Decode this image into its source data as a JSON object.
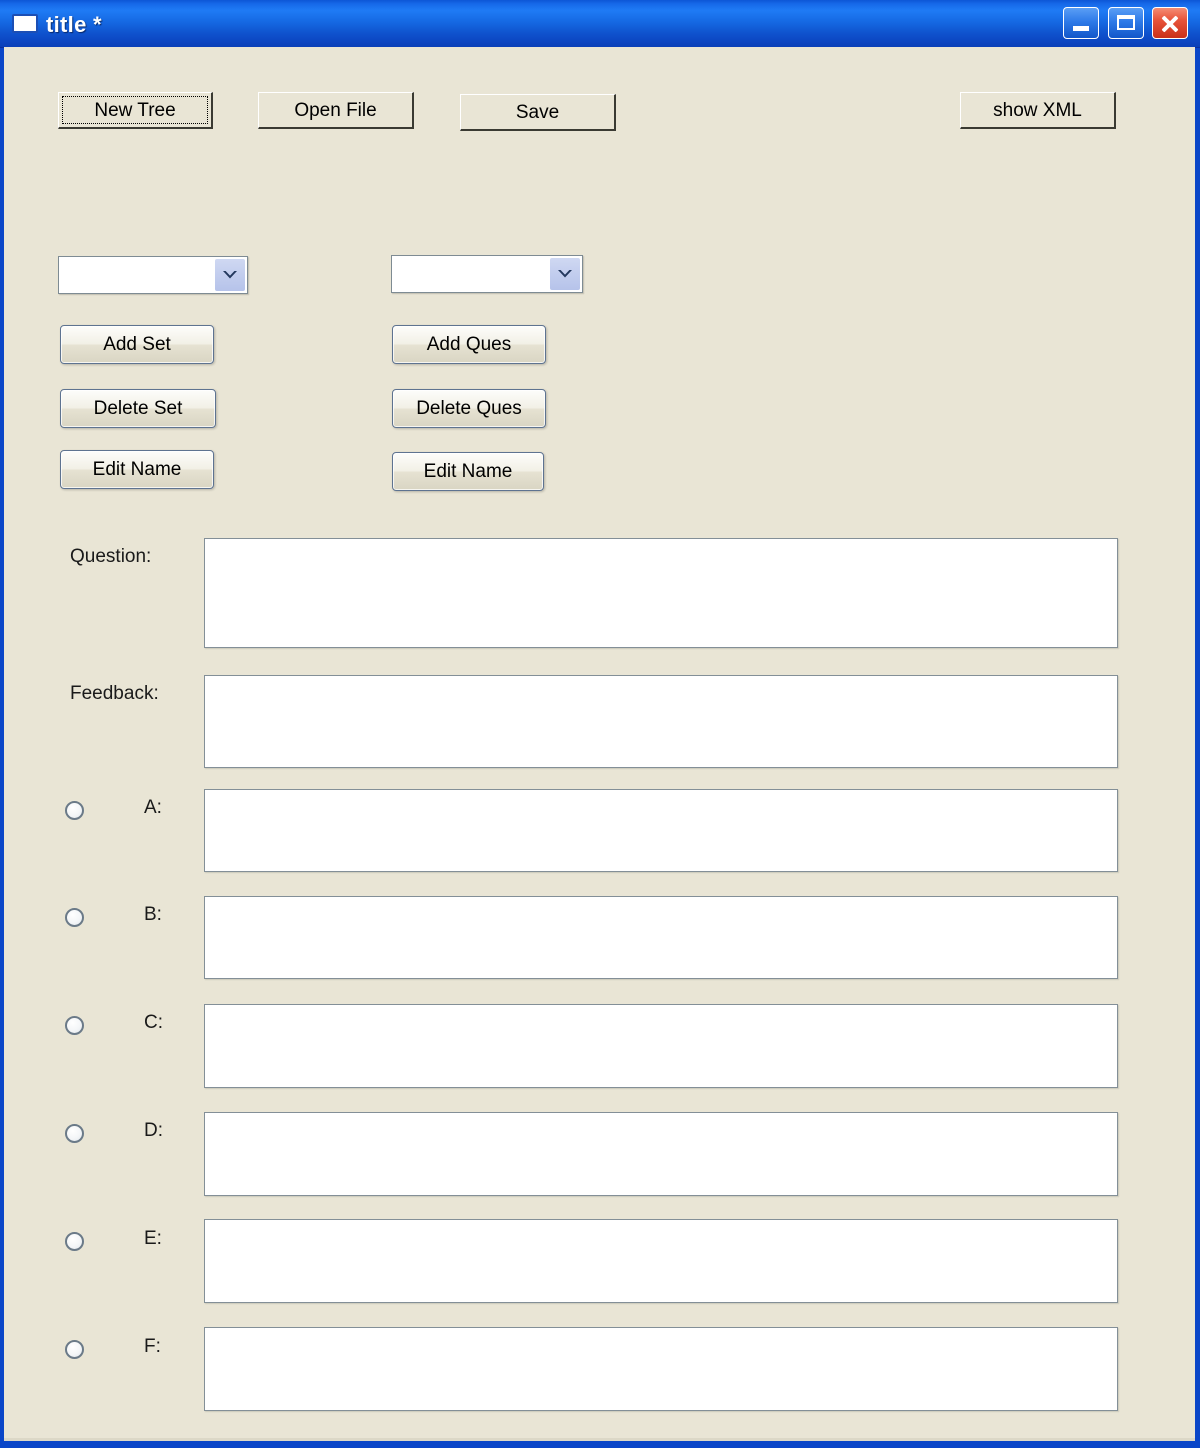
{
  "window": {
    "title": "title *",
    "icon": "window-icon",
    "controls": {
      "minimize": "minimize-button",
      "maximize": "maximize-button",
      "close": "close-button"
    },
    "frame_color": "#0a46c8",
    "client_bg": "#e9e5d5"
  },
  "toolbar": {
    "new_tree_label": "New Tree",
    "open_file_label": "Open File",
    "save_label": "Save",
    "show_xml_label": "show XML"
  },
  "sets_panel": {
    "combo_value": "",
    "combo_placeholder": "",
    "add_label": "Add Set",
    "delete_label": "Delete Set",
    "edit_label": "Edit Name"
  },
  "questions_panel": {
    "combo_value": "",
    "combo_placeholder": "",
    "add_label": "Add Ques",
    "delete_label": "Delete Ques",
    "edit_label": "Edit Name"
  },
  "editor": {
    "question_label": "Question:",
    "question_value": "",
    "feedback_label": "Feedback:",
    "feedback_value": "",
    "answers": [
      {
        "label": "A:",
        "value": "",
        "selected": false
      },
      {
        "label": "B:",
        "value": "",
        "selected": false
      },
      {
        "label": "C:",
        "value": "",
        "selected": false
      },
      {
        "label": "D:",
        "value": "",
        "selected": false
      },
      {
        "label": "E:",
        "value": "",
        "selected": false
      },
      {
        "label": "F:",
        "value": "",
        "selected": false
      }
    ]
  }
}
